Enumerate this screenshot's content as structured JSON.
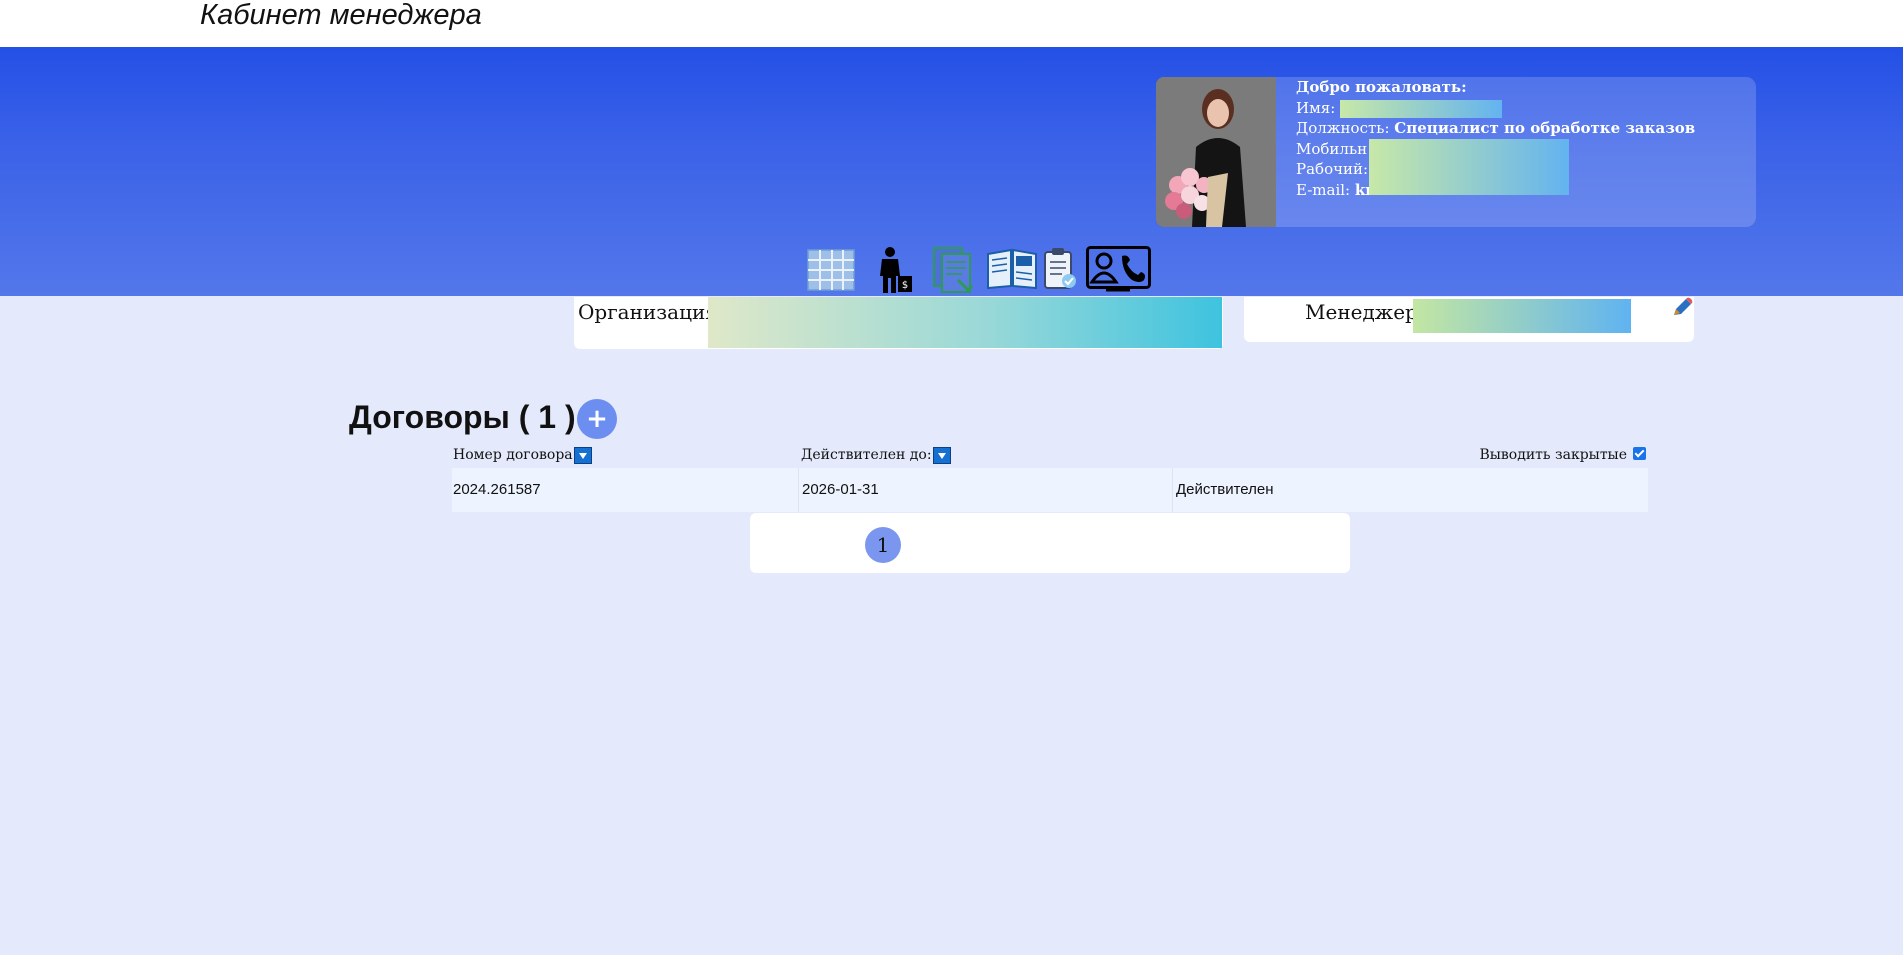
{
  "header": {
    "title": "Кабинет менеджера"
  },
  "profile": {
    "welcome": "Добро пожаловать:",
    "name_label": "Имя:",
    "position_label": "Должность:",
    "position_value": "Специалист по обработке заказов",
    "mobile_label": "Мобильн",
    "work_label": "Рабочий: 8",
    "email_label": "E-mail:",
    "email_value": "kr"
  },
  "toolbar": {
    "icons": [
      "spreadsheet-icon",
      "businessman-money-icon",
      "documents-icon",
      "open-book-icon",
      "clipboard-check-icon",
      "contact-phone-icon"
    ]
  },
  "organization": {
    "label": "Организация:"
  },
  "manager": {
    "label": "Менеджер:"
  },
  "contracts": {
    "title": "Договоры ( 1 )",
    "add_label": "+",
    "columns": {
      "number": "Номер договора",
      "valid_until": "Действителен до:"
    },
    "show_closed_label": "Выводить закрытые",
    "rows": [
      {
        "number": "2024.261587",
        "valid_until": "2026-01-31",
        "status": "Действителен"
      }
    ],
    "pages": [
      "1"
    ]
  }
}
